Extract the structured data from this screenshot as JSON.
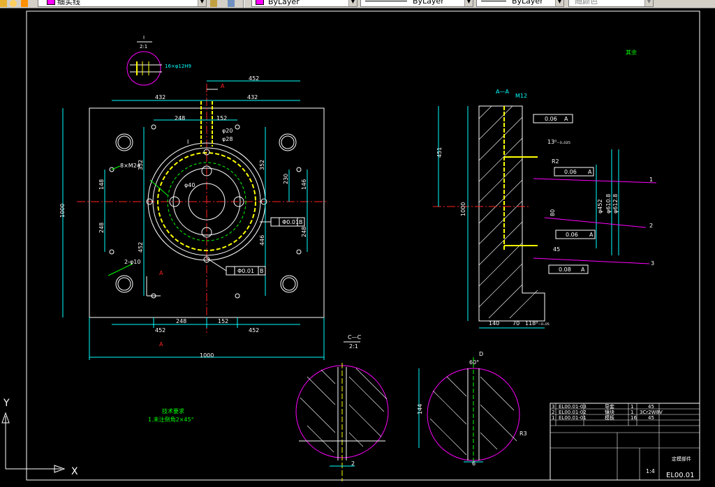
{
  "toolbar": {
    "layer_name": "细实线",
    "color": "ByLayer",
    "linetype": "ByLayer",
    "lineweight": "ByLayer",
    "plotstyle": "随颜色"
  },
  "drawing": {
    "detail_I_label": "I",
    "detail_I_scale": "2:1",
    "detail_I_note": "16×φ12H9",
    "plan_dims": {
      "top_452": "452",
      "top_432_left": "432",
      "top_432_right": "432",
      "d248_top": "248",
      "d152_top": "152",
      "phi20": "φ20",
      "phi28": "φ28",
      "d1000_left": "1000",
      "d148_left": "148",
      "d352_left": "352",
      "d248_left": "248",
      "d452_left": "452",
      "d352_right": "352",
      "d230": "230",
      "d146": "146",
      "d446": "446",
      "d248_right": "248",
      "bot_452_left": "452",
      "bot_248": "248",
      "bot_152": "152",
      "bot_452_right": "452",
      "bot_1000": "1000",
      "m24": "8×M24",
      "phi40": "φ40",
      "holes_note": "2-φ10",
      "tol_phi001_upper": "Φ0.01",
      "tol_B_upper": "B",
      "tol_phi001_lower": "Φ0.01",
      "tol_B_lower": "B",
      "section_A": "A",
      "section_I": "I"
    },
    "section_AA": {
      "title": "A—A",
      "m12": "M12",
      "tol1": "0.06",
      "tol1_ref": "A",
      "tol2": "0.06",
      "tol2_ref": "A",
      "tol3": "0.06",
      "tol3_ref": "A",
      "tol4": "0.08",
      "tol4_ref": "A",
      "d451": "451",
      "d1000": "1000",
      "d140": "140",
      "d70": "70",
      "d118": "118⁰₋₀.₀₅",
      "d13": "13⁰₋₀.₀₂₅",
      "d452": "φ452",
      "d610": "φ610.8",
      "d612": "φ612.8",
      "r2": "R2",
      "d45": "45",
      "d80": "80",
      "leader1": "1",
      "leader2": "2",
      "leader3": "3"
    },
    "note_top_right": "其余",
    "section_CC": {
      "title": "C—C",
      "scale": "2:1",
      "dim2": "2"
    },
    "section_D": {
      "title": "D",
      "angle": "60°",
      "dim144": "144",
      "r3": "R3",
      "dim6": "6"
    },
    "tech_req": {
      "title": "技术要求",
      "line1": "1.未注倒角2×45°"
    },
    "title_block": {
      "rows": [
        {
          "no": "3",
          "code": "EL00.01-03",
          "name": "导套",
          "qty": "1",
          "mat": "45"
        },
        {
          "no": "2",
          "code": "EL00.01-02",
          "name": "镶块",
          "qty": "1",
          "mat": "3Cr2W8V"
        },
        {
          "no": "1",
          "code": "EL00.01-01",
          "name": "模板",
          "qty": "16",
          "mat": "45"
        }
      ],
      "scale": "1:4",
      "drawing_no": "EL00.01",
      "part_name": "定模部件"
    },
    "ucs": {
      "x": "X",
      "y": "Y"
    }
  }
}
